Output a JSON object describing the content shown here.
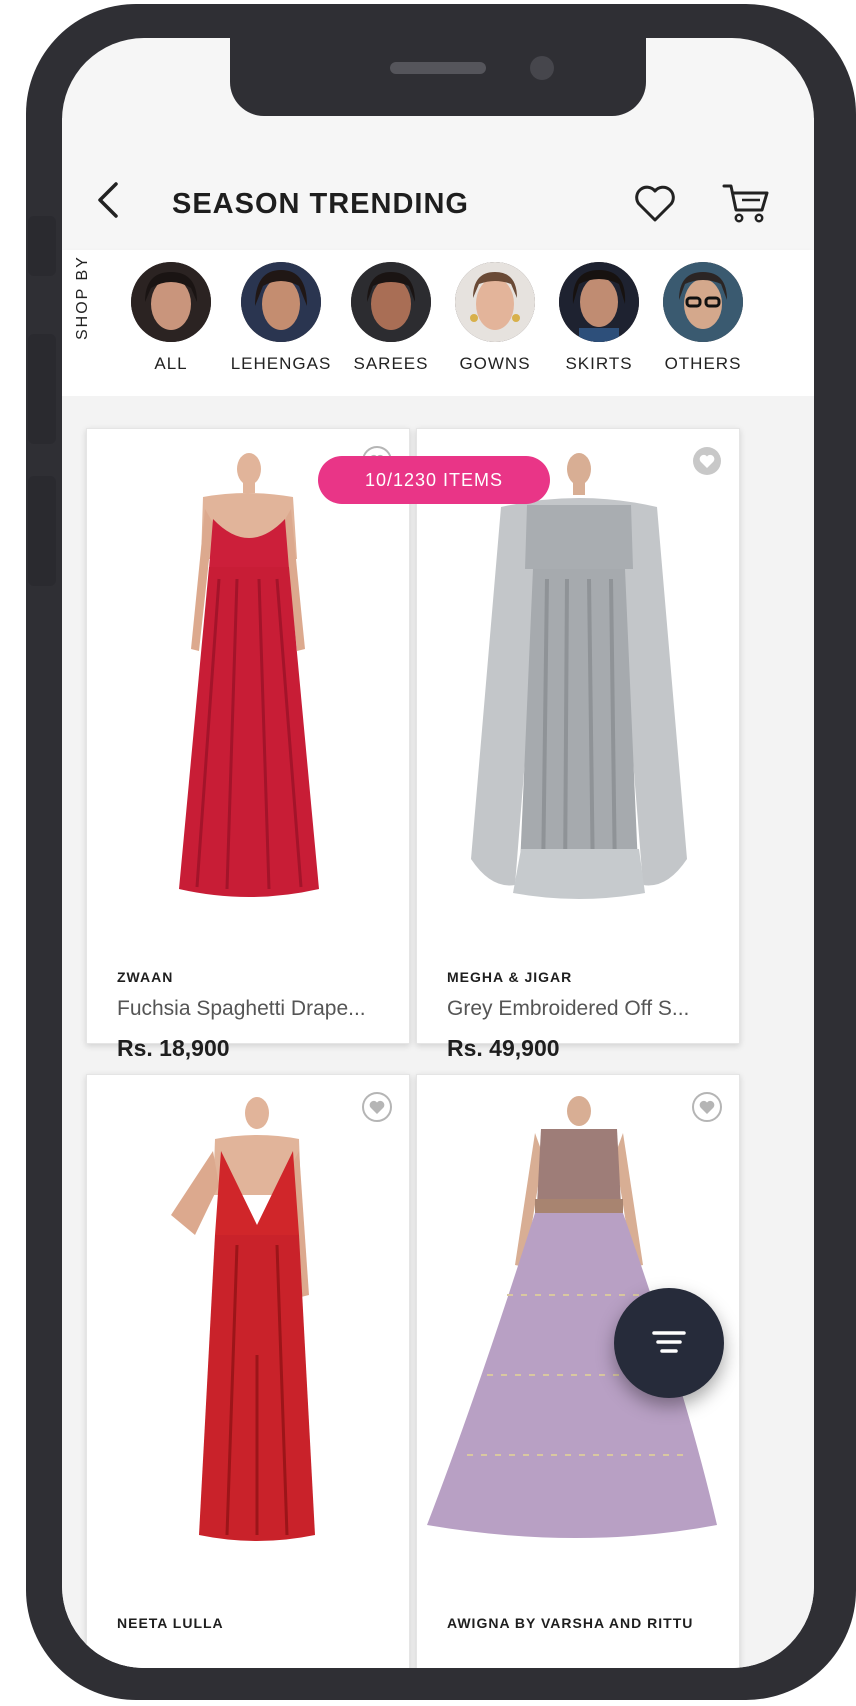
{
  "header": {
    "title": "SEASON TRENDING"
  },
  "shop_by": {
    "label": "SHOP BY",
    "categories": [
      {
        "label": "ALL"
      },
      {
        "label": "LEHENGAS"
      },
      {
        "label": "SAREES"
      },
      {
        "label": "GOWNS"
      },
      {
        "label": "SKIRTS"
      },
      {
        "label": "OTHERS"
      }
    ]
  },
  "items_count": "10/1230 ITEMS",
  "products": [
    {
      "brand": "ZWAAN",
      "name": "Fuchsia Spaghetti Drape...",
      "price": "Rs. 18,900"
    },
    {
      "brand": "MEGHA & JIGAR",
      "name": "Grey Embroidered Off S...",
      "price": "Rs. 49,900"
    },
    {
      "brand": "NEETA LULLA",
      "name": "",
      "price": ""
    },
    {
      "brand": "AWIGNA BY VARSHA AND RITTU",
      "name": "",
      "price": ""
    }
  ],
  "colors": {
    "accent": "#e93587",
    "fab": "#262b3a",
    "phone": "#2f2f34"
  },
  "icons": [
    "chevron-left-icon",
    "heart-icon",
    "cart-icon",
    "filter-icon"
  ]
}
